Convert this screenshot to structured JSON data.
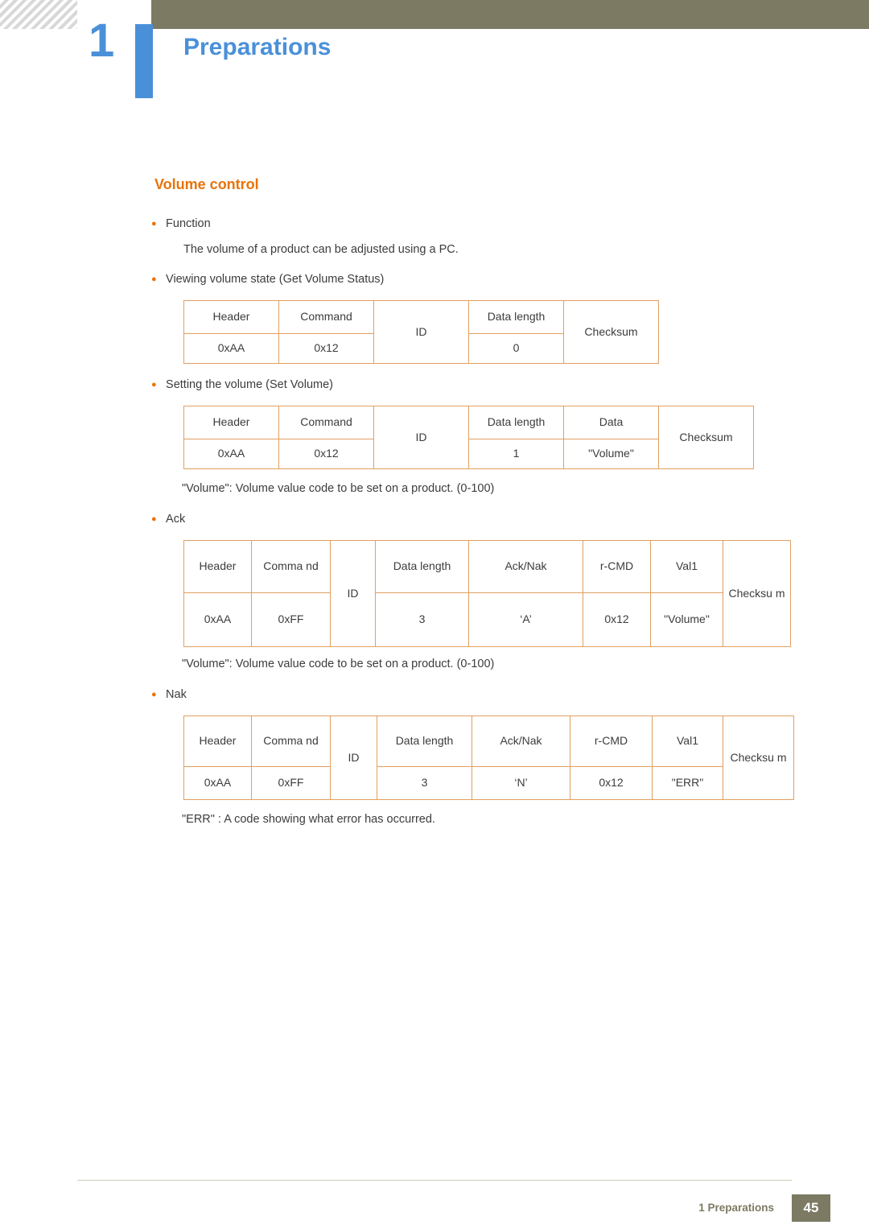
{
  "header": {
    "chapter_number": "1",
    "chapter_title": "Preparations"
  },
  "section": {
    "title": "Volume control"
  },
  "bullets": {
    "function": "Function",
    "function_desc": "The volume of a product can be adjusted using a PC.",
    "get_volume": "Viewing volume state (Get Volume Status)",
    "set_volume": "Setting the volume (Set Volume)",
    "volume_note_1": "\"Volume\": Volume value code to be set on a product. (0-100)",
    "ack": "Ack",
    "volume_note_2": "\"Volume\": Volume value code to be set on a product. (0-100)",
    "nak": "Nak",
    "err_note": "\"ERR\" : A code showing what error has occurred."
  },
  "tables": {
    "get_volume": {
      "headers": [
        "Header",
        "Command",
        "ID",
        "Data length",
        "Checksum"
      ],
      "values": [
        "0xAA",
        "0x12",
        "",
        "0",
        ""
      ]
    },
    "set_volume": {
      "headers": [
        "Header",
        "Command",
        "ID",
        "Data length",
        "Data",
        "Checksum"
      ],
      "values": [
        "0xAA",
        "0x12",
        "",
        "1",
        "\"Volume\"",
        ""
      ]
    },
    "ack": {
      "headers": [
        "Header",
        "Comma nd",
        "ID",
        "Data length",
        "Ack/Nak",
        "r-CMD",
        "Val1",
        "Checksu m"
      ],
      "values": [
        "0xAA",
        "0xFF",
        "",
        "3",
        "‘A’",
        "0x12",
        "\"Volume\"",
        ""
      ]
    },
    "nak": {
      "headers": [
        "Header",
        "Comma nd",
        "ID",
        "Data length",
        "Ack/Nak",
        "r-CMD",
        "Val1",
        "Checksu m"
      ],
      "values": [
        "0xAA",
        "0xFF",
        "",
        "3",
        "‘N’",
        "0x12",
        "\"ERR\"",
        ""
      ]
    }
  },
  "footer": {
    "label": "1 Preparations",
    "page": "45"
  }
}
